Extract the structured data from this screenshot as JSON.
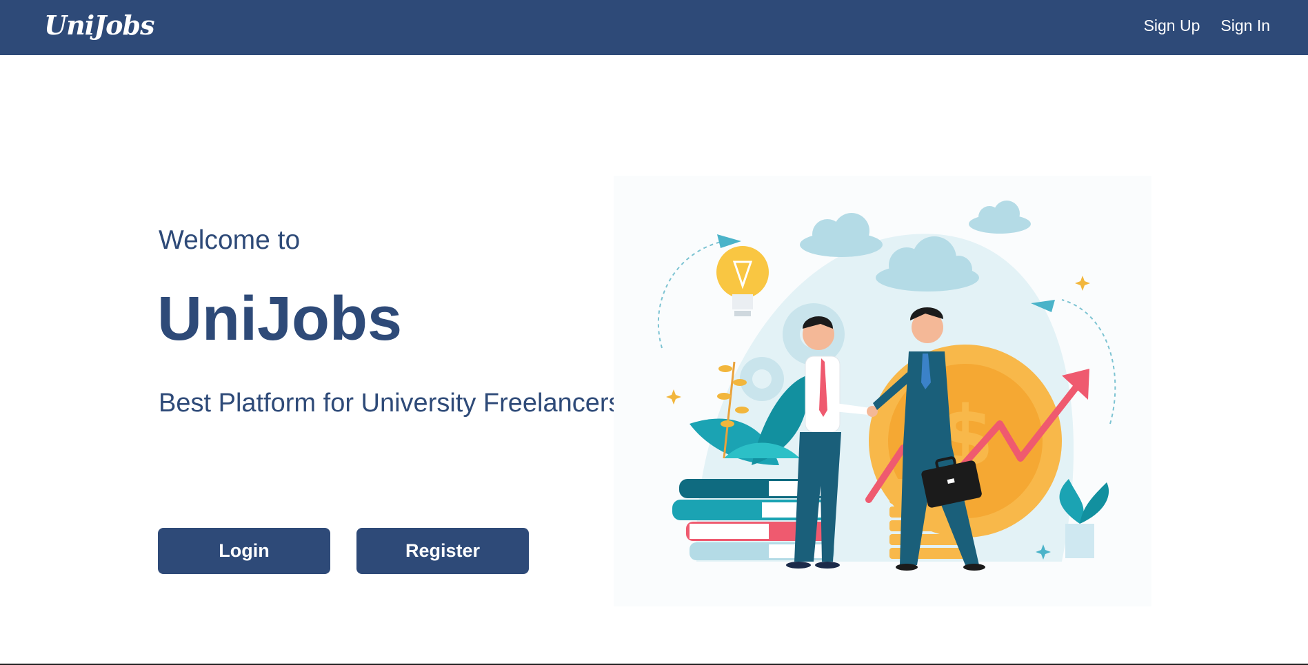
{
  "navbar": {
    "brand": "UniJobs",
    "links": [
      {
        "label": "Sign Up"
      },
      {
        "label": "Sign In"
      }
    ]
  },
  "hero": {
    "welcome": "Welcome to",
    "title": "UniJobs",
    "tagline": "Best Platform for University Freelancers",
    "buttons": {
      "login": "Login",
      "register": "Register"
    },
    "illustration": {
      "icon": "business-handshake-illustration"
    }
  },
  "colors": {
    "primary": "#2e4a78",
    "background": "#ffffff",
    "accent_coin": "#f8b84a",
    "accent_teal": "#1ba3b3",
    "accent_red": "#ef5a6f"
  }
}
